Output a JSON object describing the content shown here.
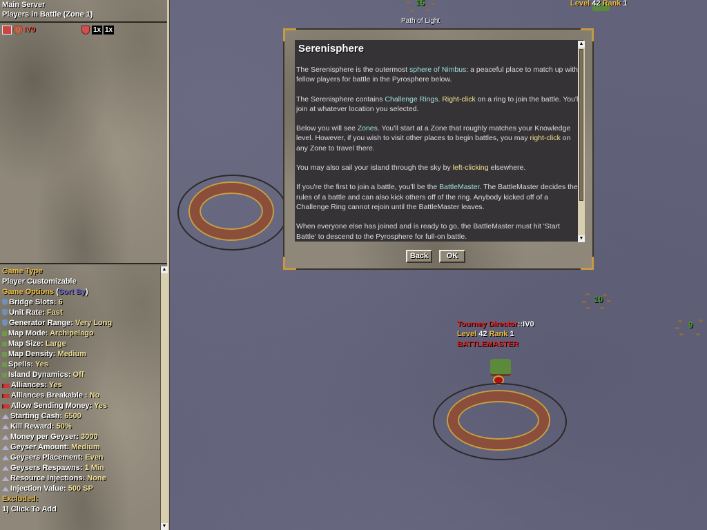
{
  "sidebar": {
    "server": "Main Server",
    "players_header": "Players in Battle (Zone 1)",
    "player": {
      "name": "IV0",
      "multiplier_a": "1x",
      "multiplier_b": "1x"
    },
    "game_type_label": "Game Type",
    "game_type_value": "Player Customizable",
    "game_options_label": "Game Options",
    "sort_open": "(",
    "sort_by": "Sort By",
    "sort_close": ")",
    "options": [
      {
        "icon": "shield",
        "label": "Bridge Slots:",
        "value": "6"
      },
      {
        "icon": "shield",
        "label": "Unit Rate:",
        "value": "Fast"
      },
      {
        "icon": "shield",
        "label": "Generator Range:",
        "value": "Very Long"
      },
      {
        "icon": "square",
        "label": "Map Mode:",
        "value": "Archipelago"
      },
      {
        "icon": "square",
        "label": "Map Size:",
        "value": "Large"
      },
      {
        "icon": "square",
        "label": "Map Density:",
        "value": "Medium"
      },
      {
        "icon": "square",
        "label": "Spells:",
        "value": "Yes"
      },
      {
        "icon": "square",
        "label": "Island Dynamics:",
        "value": "Off"
      },
      {
        "icon": "flag",
        "label": "Alliances:",
        "value": "Yes"
      },
      {
        "icon": "flag",
        "label": "Alliances Breakable :",
        "value": "No"
      },
      {
        "icon": "flag",
        "label": "Allow Sending Money:",
        "value": "Yes"
      },
      {
        "icon": "triangle",
        "label": "Starting Cash:",
        "value": "6500"
      },
      {
        "icon": "triangle",
        "label": "Kill Reward:",
        "value": "50%"
      },
      {
        "icon": "triangle",
        "label": "Money per Geyser:",
        "value": "3000"
      },
      {
        "icon": "triangle",
        "label": "Geyser Amount:",
        "value": "Medium"
      },
      {
        "icon": "triangle",
        "label": "Geysers Placement:",
        "value": "Even"
      },
      {
        "icon": "triangle",
        "label": "Geysers Respawns:",
        "value": "1 Min"
      },
      {
        "icon": "triangle",
        "label": "Resource Injections:",
        "value": "None"
      },
      {
        "icon": "triangle",
        "label": "Injection Value:",
        "value": "500 SP"
      }
    ],
    "excluded_label": "Excluded:",
    "excluded_add": "1) Click To Add",
    "scroll_up": "▲",
    "scroll_down": "▼"
  },
  "map": {
    "top_zone": {
      "number": "15",
      "label": "Path of Light"
    },
    "top_player": {
      "level_label": "Level",
      "level": "42",
      "rank_label": "Rank",
      "rank": "1"
    },
    "zone_10": "10",
    "zone_9": "9",
    "director": {
      "title": "Tourney Director",
      "sep": "::",
      "name": "IV0",
      "level_label": "Level",
      "level": "42",
      "rank_label": "Rank",
      "rank": "1",
      "role": "BATTLEMASTER"
    }
  },
  "dialog": {
    "title": "Serenisphere",
    "p1": [
      "The Serenisphere is the outermost ",
      "sphere of Nimbus",
      ": a peaceful place to match up with fellow players for battle in the Pyrosphere below."
    ],
    "p2": [
      "The Serenisphere contains ",
      "Challenge Rings",
      ". ",
      "Right-click",
      " on a ring to join the battle. You'll join at whatever location you selected."
    ],
    "p3": [
      "Below you will see ",
      "Zones",
      ". You'll start at a Zone that roughly matches your Knowledge level. However, if you wish to visit other places to begin battles, you may ",
      "right-click",
      " on any Zone to travel there."
    ],
    "p4": [
      "You may also sail your island through the sky by ",
      "left-clicking",
      " elsewhere."
    ],
    "p5": [
      "If you're the first to join a battle, you'll be the ",
      "BattleMaster",
      ".  The BattleMaster decides the rules of a battle and can also kick others off of the ring. Anybody kicked off of a Challenge Ring cannot rejoin until the BattleMaster leaves."
    ],
    "p6": [
      "When everyone else has joined and is ready to go, the BattleMaster must hit 'Start Battle' to descend to the Pyrosphere for full-on battle."
    ],
    "back_label": "Back",
    "ok_label": "OK",
    "scroll_up": "▲",
    "scroll_down": "▼"
  }
}
